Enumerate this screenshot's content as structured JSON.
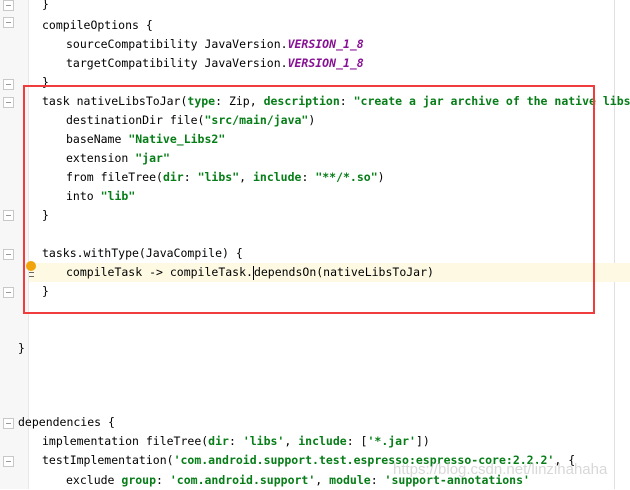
{
  "editor": {
    "lines": [
      {
        "indent": 1,
        "segs": [
          [
            "t",
            "}"
          ]
        ]
      },
      {
        "indent": 1,
        "segs": [
          [
            "t",
            "compileOptions {"
          ]
        ]
      },
      {
        "indent": 2,
        "segs": [
          [
            "t",
            "sourceCompatibility JavaVersion."
          ],
          [
            "c",
            "VERSION_1_8"
          ]
        ]
      },
      {
        "indent": 2,
        "segs": [
          [
            "t",
            "targetCompatibility JavaVersion."
          ],
          [
            "c",
            "VERSION_1_8"
          ]
        ]
      },
      {
        "indent": 1,
        "segs": [
          [
            "t",
            "}"
          ]
        ]
      },
      {
        "indent": 1,
        "segs": [
          [
            "t",
            "task nativeLibsToJar("
          ],
          [
            "n",
            "type"
          ],
          [
            "t",
            ": Zip, "
          ],
          [
            "n",
            "description"
          ],
          [
            "t",
            ": "
          ],
          [
            "s",
            "\"create a jar archive of the native libs\""
          ],
          [
            "t",
            ") {"
          ]
        ]
      },
      {
        "indent": 2,
        "segs": [
          [
            "t",
            "destinationDir file("
          ],
          [
            "s",
            "\"src/main/java\""
          ],
          [
            "t",
            ")"
          ]
        ]
      },
      {
        "indent": 2,
        "segs": [
          [
            "t",
            "baseName "
          ],
          [
            "s",
            "\"Native_Libs2\""
          ]
        ]
      },
      {
        "indent": 2,
        "segs": [
          [
            "t",
            "extension "
          ],
          [
            "s",
            "\"jar\""
          ]
        ]
      },
      {
        "indent": 2,
        "segs": [
          [
            "t",
            "from fileTree("
          ],
          [
            "n",
            "dir"
          ],
          [
            "t",
            ": "
          ],
          [
            "s",
            "\"libs\""
          ],
          [
            "t",
            ", "
          ],
          [
            "n",
            "include"
          ],
          [
            "t",
            ": "
          ],
          [
            "s",
            "\"**/*.so\""
          ],
          [
            "t",
            ")"
          ]
        ]
      },
      {
        "indent": 2,
        "segs": [
          [
            "t",
            "into "
          ],
          [
            "s",
            "\"lib\""
          ]
        ]
      },
      {
        "indent": 1,
        "segs": [
          [
            "t",
            "}"
          ]
        ]
      },
      {
        "indent": 0,
        "segs": []
      },
      {
        "indent": 1,
        "segs": [
          [
            "t",
            "tasks.withType(JavaCompile) {"
          ]
        ]
      },
      {
        "indent": 2,
        "current": true,
        "segs": [
          [
            "t",
            "compileTask -> compileTask."
          ],
          [
            "caret",
            ""
          ],
          [
            "t",
            "dependsOn(nativeLibsToJar)"
          ]
        ]
      },
      {
        "indent": 1,
        "segs": [
          [
            "t",
            "}"
          ]
        ]
      },
      {
        "indent": 0,
        "segs": []
      },
      {
        "indent": 0,
        "segs": []
      },
      {
        "indent": 0,
        "segs": [
          [
            "t",
            "}"
          ]
        ]
      },
      {
        "indent": 0,
        "segs": []
      },
      {
        "indent": 0,
        "segs": []
      },
      {
        "indent": 0,
        "segs": []
      },
      {
        "indent": 0,
        "segs": [
          [
            "t",
            "dependencies {"
          ]
        ]
      },
      {
        "indent": 1,
        "segs": [
          [
            "t",
            "implementation fileTree("
          ],
          [
            "n",
            "dir"
          ],
          [
            "t",
            ": "
          ],
          [
            "s",
            "'libs'"
          ],
          [
            "t",
            ", "
          ],
          [
            "n",
            "include"
          ],
          [
            "t",
            ": ["
          ],
          [
            "s",
            "'*.jar'"
          ],
          [
            "t",
            "])"
          ]
        ]
      },
      {
        "indent": 1,
        "segs": [
          [
            "t",
            "testImplementation("
          ],
          [
            "s",
            "'com.android.support.test.espresso:espresso-core:2.2.2'"
          ],
          [
            "t",
            ", {"
          ]
        ]
      },
      {
        "indent": 2,
        "segs": [
          [
            "t",
            "exclude "
          ],
          [
            "n",
            "group"
          ],
          [
            "t",
            ": "
          ],
          [
            "s",
            "'com.android.support'"
          ],
          [
            "t",
            ", "
          ],
          [
            "n",
            "module"
          ],
          [
            "t",
            ": "
          ],
          [
            "s",
            "'support-annotations'"
          ]
        ]
      }
    ]
  },
  "watermark": "https://blog.csdn.net/linzihahaha"
}
